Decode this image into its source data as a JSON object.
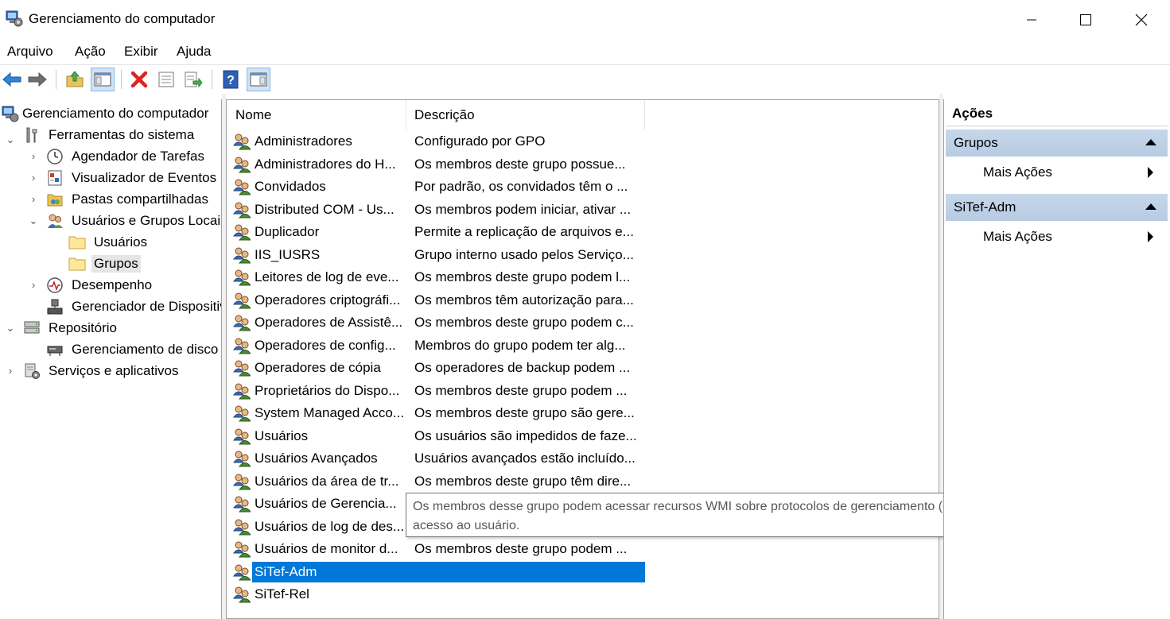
{
  "window": {
    "title": "Gerenciamento do computador",
    "minimize": "minimize-icon",
    "maximize": "maximize-icon",
    "close": "close-icon"
  },
  "menu": [
    "Arquivo",
    "Ação",
    "Exibir",
    "Ajuda"
  ],
  "toolbar": [
    "back-arrow-icon",
    "forward-arrow-icon",
    "up-folder-icon",
    "show-hide-tree-icon",
    "delete-icon",
    "properties-icon",
    "export-list-icon",
    "help-icon",
    "show-hide-action-pane-icon"
  ],
  "tree": [
    {
      "label": "Gerenciamento do computador",
      "icon": "computer-management-icon",
      "level": 0,
      "expander": ""
    },
    {
      "label": "Ferramentas do sistema",
      "icon": "system-tools-icon",
      "level": 1,
      "expander": "expanded"
    },
    {
      "label": "Agendador de Tarefas",
      "icon": "task-scheduler-icon",
      "level": 2,
      "expander": "collapsed"
    },
    {
      "label": "Visualizador de Eventos",
      "icon": "event-viewer-icon",
      "level": 2,
      "expander": "collapsed"
    },
    {
      "label": "Pastas compartilhadas",
      "icon": "shared-folders-icon",
      "level": 2,
      "expander": "collapsed"
    },
    {
      "label": "Usuários e Grupos Locais",
      "icon": "users-groups-icon",
      "level": 2,
      "expander": "expanded"
    },
    {
      "label": "Usuários",
      "icon": "folder-icon",
      "level": 3,
      "expander": ""
    },
    {
      "label": "Grupos",
      "icon": "folder-icon",
      "level": 3,
      "expander": "",
      "selected": true
    },
    {
      "label": "Desempenho",
      "icon": "performance-icon",
      "level": 2,
      "expander": "collapsed"
    },
    {
      "label": "Gerenciador de Dispositivos",
      "icon": "device-manager-icon",
      "level": 2,
      "expander": ""
    },
    {
      "label": "Repositório",
      "icon": "storage-icon",
      "level": 1,
      "expander": "expanded"
    },
    {
      "label": "Gerenciamento de disco",
      "icon": "disk-management-icon",
      "level": 2,
      "expander": ""
    },
    {
      "label": "Serviços e aplicativos",
      "icon": "services-apps-icon",
      "level": 1,
      "expander": "collapsed"
    }
  ],
  "list": {
    "columns": [
      "Nome",
      "Descrição"
    ],
    "rows": [
      {
        "name": "Administradores",
        "desc": "Configurado por GPO"
      },
      {
        "name": "Administradores do H...",
        "desc": "Os membros deste grupo possue..."
      },
      {
        "name": "Convidados",
        "desc": "Por padrão, os convidados têm o ..."
      },
      {
        "name": "Distributed COM - Us...",
        "desc": "Os membros podem iniciar, ativar ..."
      },
      {
        "name": "Duplicador",
        "desc": "Permite a replicação de arquivos e..."
      },
      {
        "name": "IIS_IUSRS",
        "desc": "Grupo interno usado pelos Serviço..."
      },
      {
        "name": "Leitores de log de eve...",
        "desc": "Os membros deste grupo podem l..."
      },
      {
        "name": "Operadores criptográfi...",
        "desc": "Os membros têm autorização para..."
      },
      {
        "name": "Operadores de Assistê...",
        "desc": "Os membros deste grupo podem c..."
      },
      {
        "name": "Operadores de config...",
        "desc": "Membros do grupo podem ter alg..."
      },
      {
        "name": "Operadores de cópia",
        "desc": "Os operadores de backup podem ..."
      },
      {
        "name": "Proprietários do Dispo...",
        "desc": "Os membros deste grupo podem ..."
      },
      {
        "name": "System Managed Acco...",
        "desc": "Os membros deste grupo são gere..."
      },
      {
        "name": "Usuários",
        "desc": "Os usuários são impedidos de faze..."
      },
      {
        "name": "Usuários Avançados",
        "desc": "Usuários avançados estão incluído..."
      },
      {
        "name": "Usuários da área de tr...",
        "desc": "Os membros deste grupo têm dire..."
      },
      {
        "name": "Usuários de Gerencia...",
        "desc": ""
      },
      {
        "name": "Usuários de log de des...",
        "desc": ""
      },
      {
        "name": "Usuários de monitor d...",
        "desc": "Os membros deste grupo podem ..."
      },
      {
        "name": "SiTef-Adm",
        "desc": "",
        "selected": true
      },
      {
        "name": "SiTef-Rel",
        "desc": ""
      }
    ],
    "tooltip": {
      "line1": "Os membros desse grupo podem acessar recursos WMI sobre protocolos de gerenciamento (como o WS-Management atravé",
      "line2": "acesso ao usuário."
    }
  },
  "actions": {
    "header": "Ações",
    "groups": [
      {
        "title": "Grupos",
        "item": "Mais Ações"
      },
      {
        "title": "SiTef-Adm",
        "item": "Mais Ações"
      }
    ]
  }
}
